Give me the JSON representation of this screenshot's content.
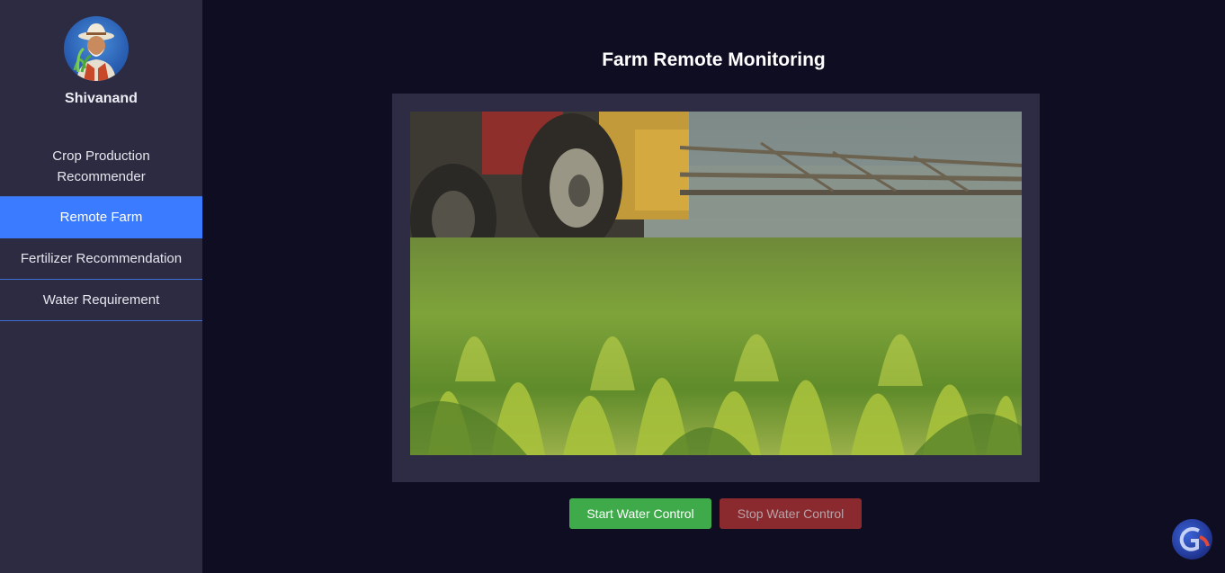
{
  "user": {
    "name": "Shivanand",
    "avatar_icon": "farmer-avatar-icon"
  },
  "sidebar": {
    "items": [
      {
        "label": "Crop Production Recommender",
        "active": false
      },
      {
        "label": "Remote Farm",
        "active": true
      },
      {
        "label": "Fertilizer Recommendation",
        "active": false
      },
      {
        "label": "Water Requirement",
        "active": false
      }
    ]
  },
  "main": {
    "title": "Farm Remote Monitoring",
    "video_content": "tractor-spraying-crop-field"
  },
  "controls": {
    "start_label": "Start Water Control",
    "stop_label": "Stop Water Control"
  },
  "colors": {
    "background": "#0e0d22",
    "sidebar": "#2c2b41",
    "active_nav": "#3a7bff",
    "start_button": "#3eaa4a",
    "stop_button": "#8a2a2e"
  }
}
